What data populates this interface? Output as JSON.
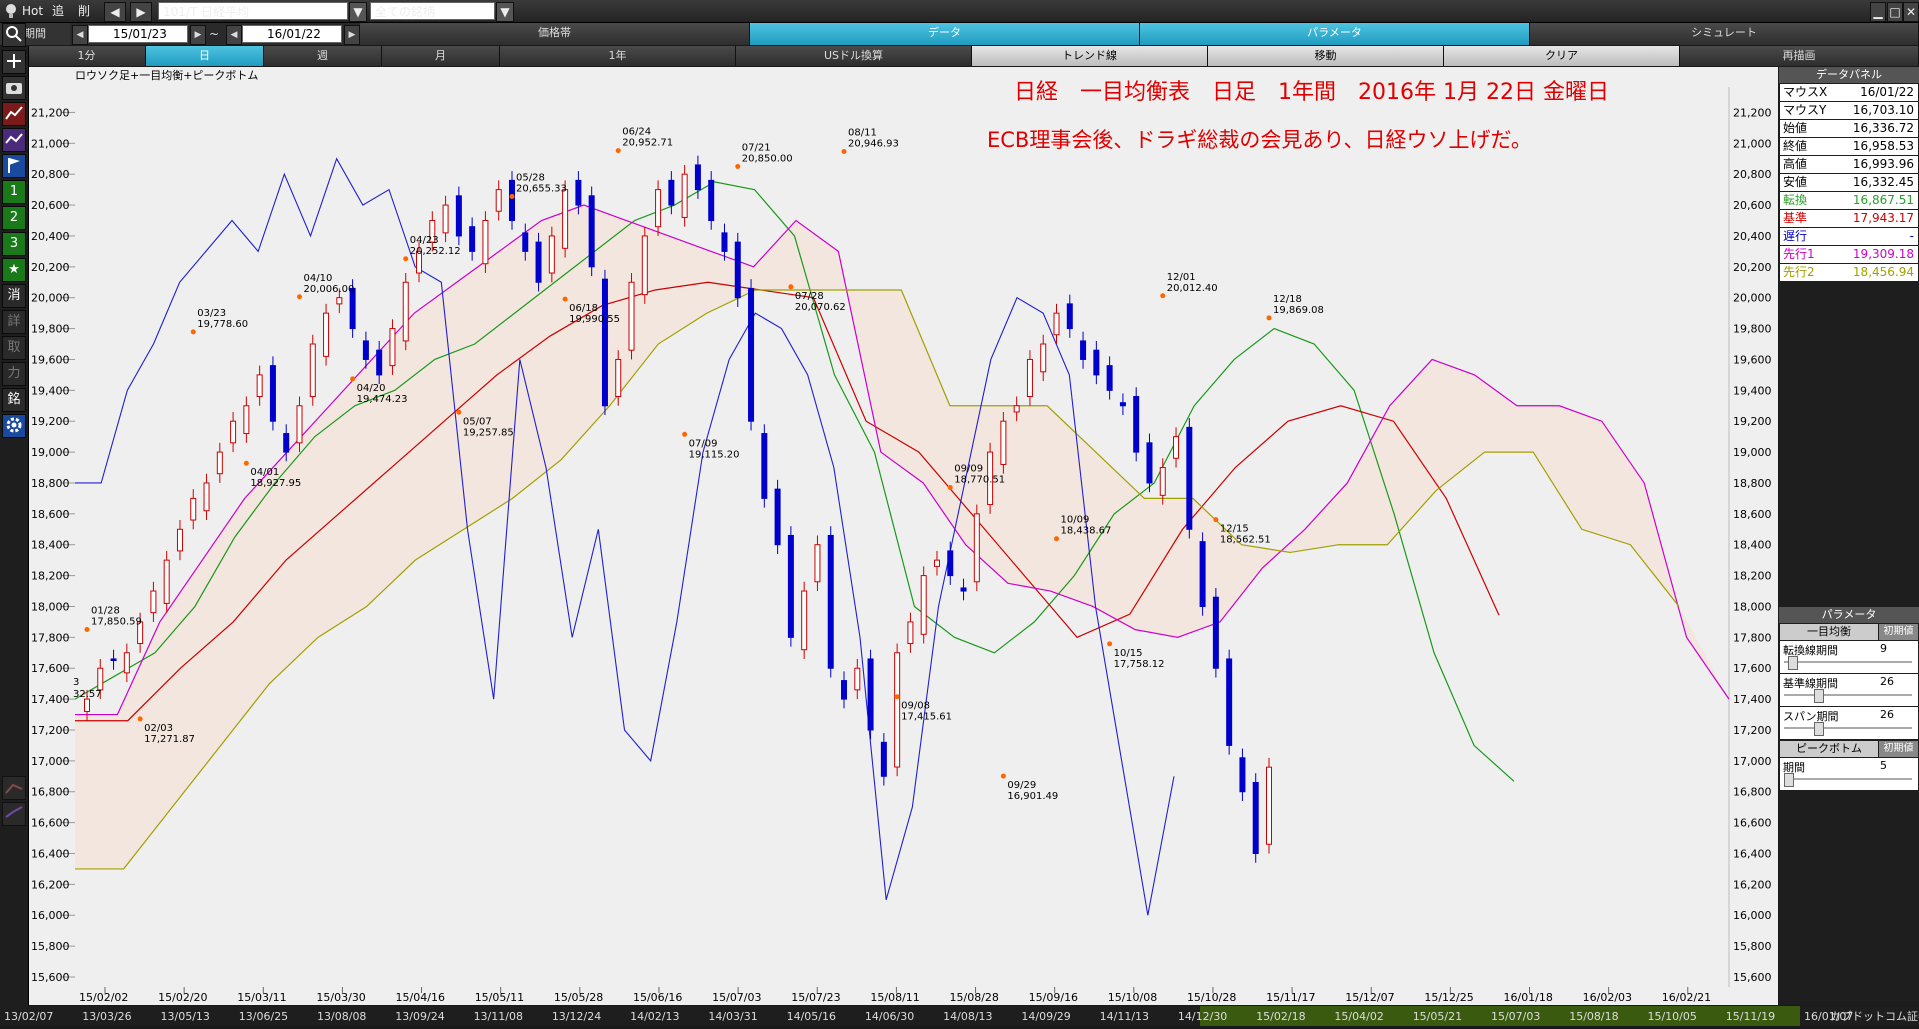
{
  "toolbar": {
    "hot": "Hot",
    "add": "追",
    "del": "削",
    "symbol": "101/T 日経平均",
    "universe": "全ての銘柄"
  },
  "period": {
    "label": "期間",
    "from": "15/01/23",
    "tilde": "~",
    "to": "16/01/22"
  },
  "tabs_top": [
    "価格帯",
    "データ",
    "パラメータ",
    "シミュレート"
  ],
  "tabs_row": [
    "1分",
    "日",
    "週",
    "月",
    "1年",
    "USドル換算",
    "トレンド線",
    "移動",
    "クリア",
    "再描画"
  ],
  "left_icons": [
    "search-icon",
    "plus-icon",
    "camera-icon",
    "chart-icon",
    "line-chart-icon",
    "flag-icon",
    "1",
    "2",
    "3",
    "★",
    "消",
    "詳",
    "取",
    "力",
    "銘",
    "gear-icon"
  ],
  "left_labels": {
    "n1": "1",
    "n2": "2",
    "n3": "3",
    "star": "★",
    "k1": "消",
    "k2": "詳",
    "k3": "取",
    "k4": "力",
    "k5": "銘"
  },
  "chart": {
    "legend": "ロウソク足+一目均衡+ピークボトム",
    "title": "日経　一目均衡表　日足　1年間　2016年 1月 22日 金曜日",
    "subtitle": "ECB理事会後、ドラギ総裁の会見あり、日経ウソ上げだ。",
    "left_edge_labels": [
      "3",
      "32.57"
    ]
  },
  "chart_data": {
    "type": "candlestick",
    "ylim": [
      15600,
      21300
    ],
    "y_ticks": [
      "21,200",
      "21,000",
      "20,800",
      "20,600",
      "20,400",
      "20,200",
      "20,000",
      "19,800",
      "19,600",
      "19,400",
      "19,200",
      "19,000",
      "18,800",
      "18,600",
      "18,400",
      "18,200",
      "18,000",
      "17,800",
      "17,600",
      "17,400",
      "17,200",
      "17,000",
      "16,800",
      "16,600",
      "16,400",
      "16,200",
      "16,000",
      "15,800",
      "15,600"
    ],
    "x_ticks": [
      "15/02/02",
      "15/02/20",
      "15/03/11",
      "15/03/30",
      "15/04/16",
      "15/05/11",
      "15/05/28",
      "15/06/16",
      "15/07/03",
      "15/07/23",
      "15/08/11",
      "15/08/28",
      "15/09/16",
      "15/10/08",
      "15/10/28",
      "15/11/17",
      "15/12/07",
      "15/12/25",
      "16/01/18",
      "16/02/03",
      "16/02/21"
    ],
    "peaks": [
      {
        "date": "01/28",
        "value": "17,850.59"
      },
      {
        "date": "02/03",
        "value": "17,271.87"
      },
      {
        "date": "03/23",
        "value": "19,778.60"
      },
      {
        "date": "04/01",
        "value": "18,927.95"
      },
      {
        "date": "04/10",
        "value": "20,006.00"
      },
      {
        "date": "04/20",
        "value": "19,474.23"
      },
      {
        "date": "04/23",
        "value": "20,252.12"
      },
      {
        "date": "05/07",
        "value": "19,257.85"
      },
      {
        "date": "05/28",
        "value": "20,655.33"
      },
      {
        "date": "06/18",
        "value": "19,990.55"
      },
      {
        "date": "06/24",
        "value": "20,952.71"
      },
      {
        "date": "07/09",
        "value": "19,115.20"
      },
      {
        "date": "07/21",
        "value": "20,850.00"
      },
      {
        "date": "07/28",
        "value": "20,070.62"
      },
      {
        "date": "08/11",
        "value": "20,946.93"
      },
      {
        "date": "09/08",
        "value": "17,415.61"
      },
      {
        "date": "09/09",
        "value": "18,770.51"
      },
      {
        "date": "09/29",
        "value": "16,901.49"
      },
      {
        "date": "10/09",
        "value": "18,438.67"
      },
      {
        "date": "10/15",
        "value": "17,758.12"
      },
      {
        "date": "12/01",
        "value": "20,012.40"
      },
      {
        "date": "12/15",
        "value": "18,562.51"
      },
      {
        "date": "12/18",
        "value": "19,869.08"
      }
    ],
    "series": [
      {
        "name": "転換",
        "values": [
          17400,
          17550,
          17700,
          18000,
          18450,
          18800,
          19100,
          19300,
          19400,
          19600,
          19700,
          19900,
          20100,
          20300,
          20500,
          20600,
          20750,
          20700,
          20400,
          19500,
          19000,
          18000,
          17800,
          17700,
          17900,
          18200,
          18600,
          18800,
          19300,
          19600,
          19800,
          19700,
          19400,
          18600,
          17700,
          17100,
          16867.51
        ]
      },
      {
        "name": "基準",
        "values": [
          17260,
          17260,
          17600,
          17900,
          18300,
          18600,
          18900,
          19200,
          19500,
          19750,
          19950,
          20050,
          20100,
          20050,
          20000,
          19200,
          19000,
          18600,
          18200,
          17800,
          17950,
          18500,
          18900,
          19200,
          19300,
          19200,
          18700,
          17943.17
        ]
      },
      {
        "name": "先行1",
        "values": [
          17300,
          17300,
          17900,
          18300,
          18700,
          19000,
          19300,
          19600,
          19900,
          20100,
          20300,
          20500,
          20600,
          20500,
          20400,
          20300,
          20200,
          20500,
          20300,
          19000,
          18800,
          18400,
          18150,
          18100,
          18000,
          17850,
          17800,
          17900,
          18250,
          18500,
          18800,
          19300,
          19600,
          19500,
          19300,
          19300,
          19200,
          18800,
          17800,
          17400
        ]
      },
      {
        "name": "先行2",
        "values": [
          16300,
          16300,
          16700,
          17100,
          17500,
          17800,
          18000,
          18300,
          18500,
          18700,
          18950,
          19300,
          19700,
          19900,
          20050,
          20050,
          20050,
          20050,
          19300,
          19300,
          19300,
          19000,
          18700,
          18700,
          18400,
          18350,
          18400,
          18400,
          18750,
          19000,
          19000,
          18500,
          18400,
          18000
        ]
      }
    ]
  },
  "data_panel": {
    "header": "データパネル",
    "rows": [
      {
        "k": "マウスX",
        "v": "16/01/22",
        "color": "#000000"
      },
      {
        "k": "マウスY",
        "v": "16,703.10",
        "color": "#000000"
      },
      {
        "k": "始値",
        "v": "16,336.72",
        "color": "#000000"
      },
      {
        "k": "終値",
        "v": "16,958.53",
        "color": "#000000"
      },
      {
        "k": "高値",
        "v": "16,993.96",
        "color": "#000000"
      },
      {
        "k": "安値",
        "v": "16,332.45",
        "color": "#000000"
      },
      {
        "k": "転換",
        "v": "16,867.51",
        "color": "#2a9d2a"
      },
      {
        "k": "基準",
        "v": "17,943.17",
        "color": "#cc0000"
      },
      {
        "k": "遅行",
        "v": "-",
        "color": "#0000cc"
      },
      {
        "k": "先行1",
        "v": "19,309.18",
        "color": "#cc00cc"
      },
      {
        "k": "先行2",
        "v": "18,456.94",
        "color": "#a0a000"
      }
    ]
  },
  "param_panel": {
    "header": "パラメータ",
    "section1": "一目均衡",
    "reset1": "初期値",
    "p1_label": "転換線期間",
    "p1_value": "9",
    "p2_label": "基準線期間",
    "p2_value": "26",
    "p3_label": "スパン期間",
    "p3_value": "26",
    "section2": "ピークボトム",
    "reset2": "初期値",
    "p4_label": "期間",
    "p4_value": "5"
  },
  "bottom_axis": [
    "13/02/07",
    "13/03/26",
    "13/05/13",
    "13/06/25",
    "13/08/08",
    "13/09/24",
    "13/11/08",
    "13/12/24",
    "14/02/13",
    "14/03/31",
    "14/05/16",
    "14/06/30",
    "14/08/13",
    "14/09/29",
    "14/11/13",
    "14/12/30",
    "15/02/18",
    "15/04/02",
    "15/05/21",
    "15/07/03",
    "15/08/18",
    "15/10/05",
    "15/11/19",
    "16/01/07"
  ],
  "bottom_right": "カブドットコム証券",
  "colors": {
    "accent": "#1f9cc1",
    "bull": "#cc0000",
    "bear": "#0000cc"
  }
}
